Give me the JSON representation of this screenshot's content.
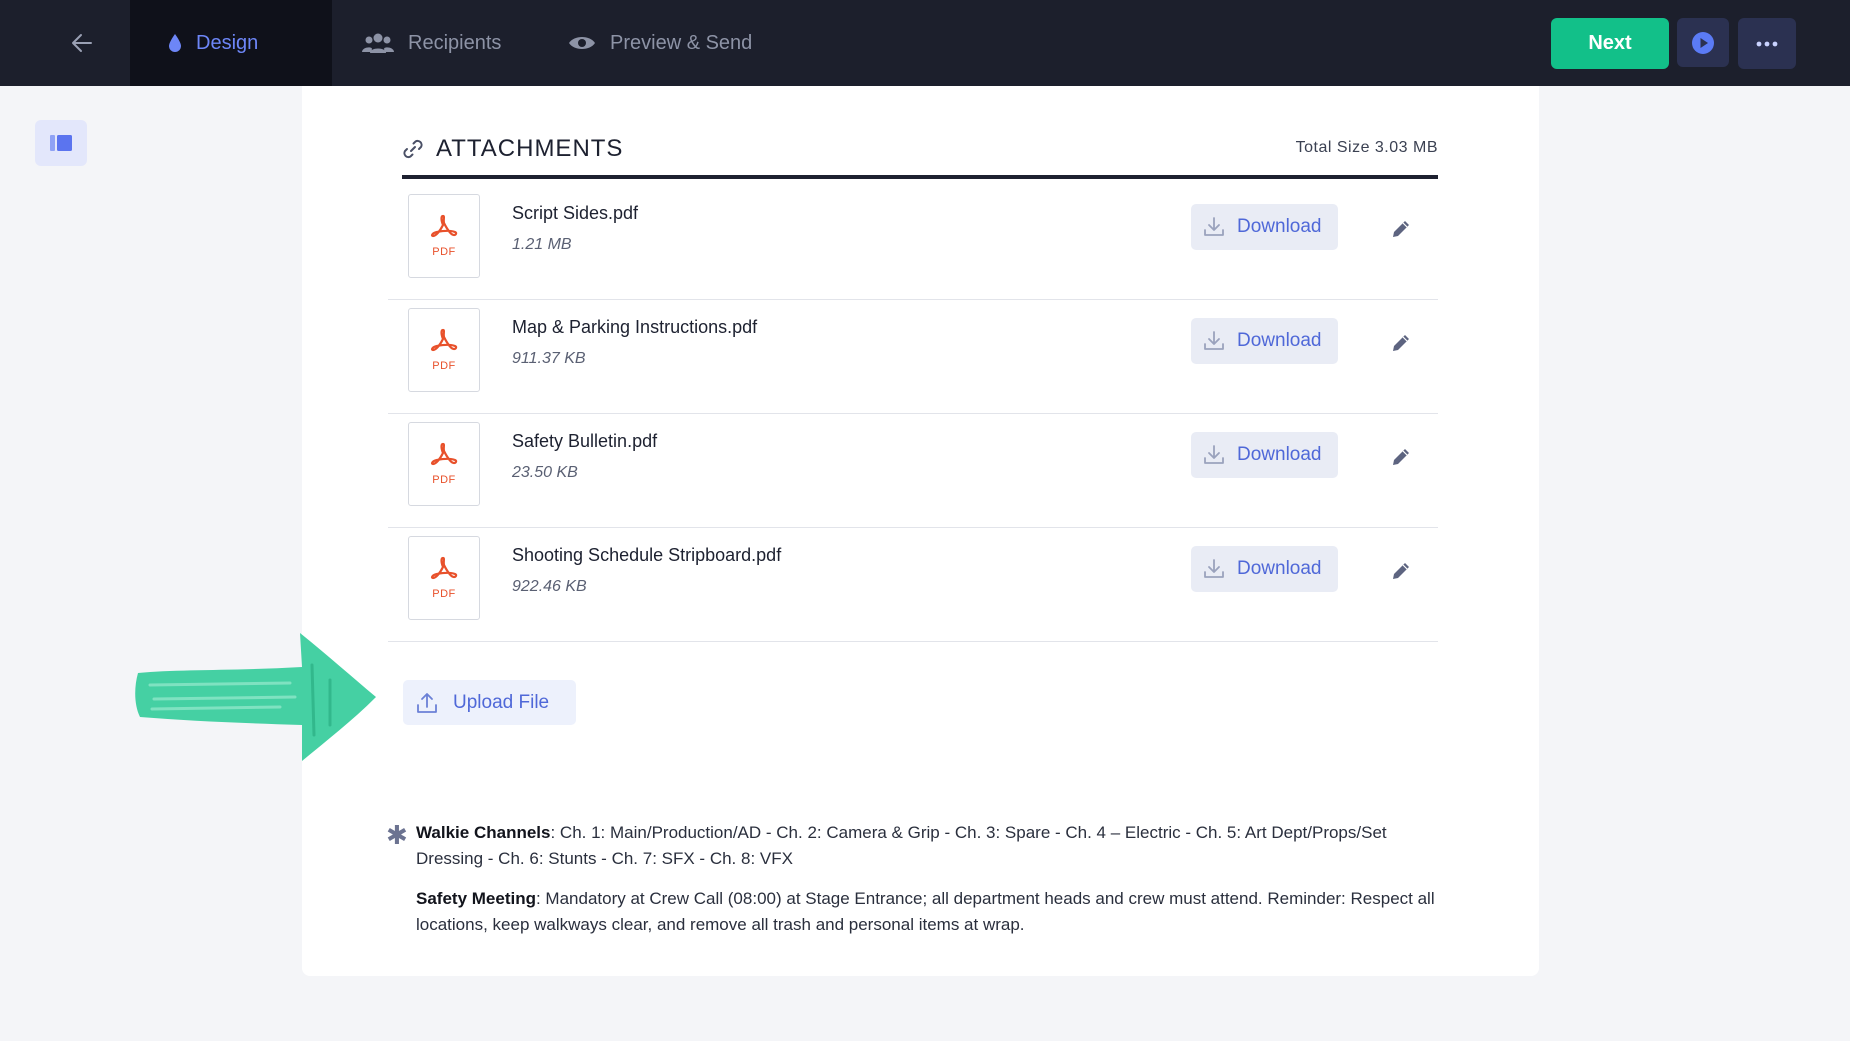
{
  "topbar": {
    "tabs": [
      {
        "label": "Design",
        "icon": "drop-icon",
        "active": true
      },
      {
        "label": "Recipients",
        "icon": "people-icon",
        "active": false
      },
      {
        "label": "Preview & Send",
        "icon": "eye-icon",
        "active": false
      }
    ],
    "next_label": "Next",
    "colors": {
      "bar": "#1c1f2c",
      "active_tab": "#0f111a",
      "accent": "#6d86f7",
      "next": "#12c089"
    }
  },
  "attachments": {
    "title": "ATTACHMENTS",
    "total_size": "Total Size 3.03 MB",
    "download_label": "Download",
    "pdf_label": "PDF",
    "files": [
      {
        "name": "Script Sides.pdf",
        "size": "1.21 MB"
      },
      {
        "name": "Map & Parking Instructions.pdf",
        "size": "911.37 KB"
      },
      {
        "name": "Safety Bulletin.pdf",
        "size": "23.50 KB"
      },
      {
        "name": "Shooting Schedule Stripboard.pdf",
        "size": "922.46 KB"
      }
    ],
    "upload_label": "Upload File"
  },
  "notes": [
    {
      "label": "Walkie Channels",
      "text": ": Ch. 1: Main/Production/AD - Ch. 2: Camera & Grip - Ch. 3: Spare - Ch. 4 – Electric - Ch. 5: Art Dept/Props/Set Dressing - Ch. 6: Stunts - Ch. 7: SFX - Ch. 8: VFX"
    },
    {
      "label": "Safety Meeting",
      "text": ": Mandatory at Crew Call (08:00) at Stage Entrance; all department heads and crew must attend. Reminder: Respect all locations, keep walkways clear, and remove all trash and personal items at wrap."
    }
  ],
  "annotation": {
    "icon": "hand-drawn-arrow-icon",
    "color": "#3ecf9e"
  }
}
